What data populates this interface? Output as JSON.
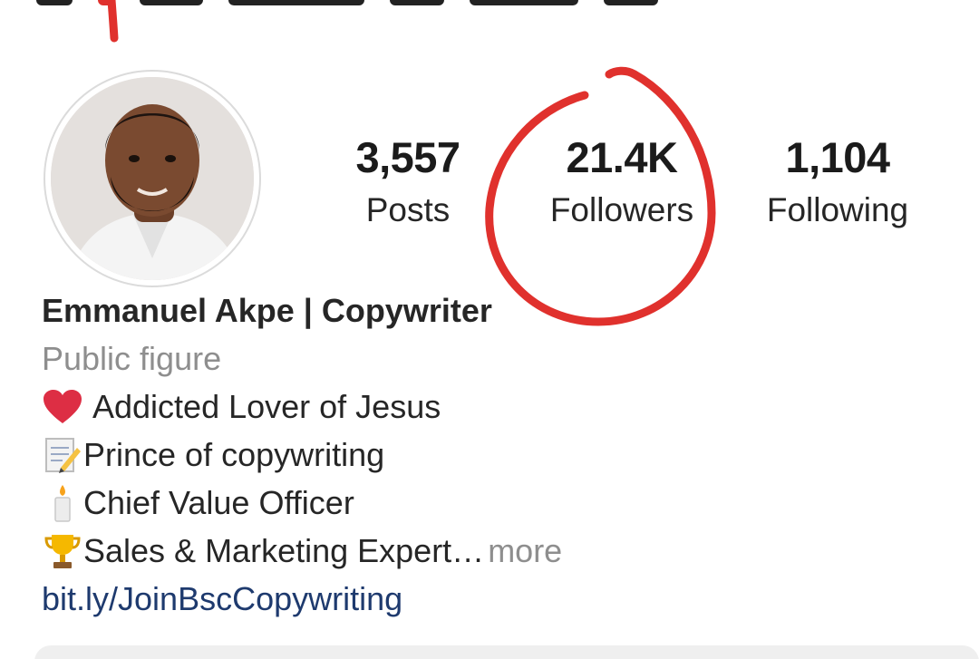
{
  "profile": {
    "avatar_icon": "profile-photo",
    "stats": [
      {
        "value": "3,557",
        "label": "Posts"
      },
      {
        "value": "21.4K",
        "label": "Followers"
      },
      {
        "value": "1,104",
        "label": "Following"
      }
    ],
    "name": "Emmanuel Akpe | Copywriter",
    "category": "Public figure",
    "bio": [
      {
        "emoji": "red-heart",
        "text": "Addicted Lover of Jesus"
      },
      {
        "emoji": "memo",
        "text": "Prince of copywriting"
      },
      {
        "emoji": "candle",
        "text": "Chief Value Officer"
      },
      {
        "emoji": "trophy",
        "text": "Sales & Marketing Expert…",
        "more": "more"
      }
    ],
    "link": "bit.ly/JoinBscCopywriting"
  },
  "annotation": {
    "color": "#e0312d"
  }
}
